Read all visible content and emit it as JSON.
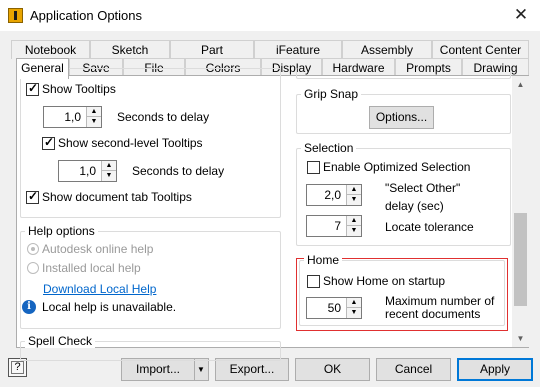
{
  "window": {
    "title": "Application Options",
    "close_glyph": "✕"
  },
  "tabs_back": [
    "Notebook",
    "Sketch",
    "Part",
    "iFeature",
    "Assembly",
    "Content Center"
  ],
  "tabs_front": [
    "General",
    "Save",
    "File",
    "Colors",
    "Display",
    "Hardware",
    "Prompts",
    "Drawing"
  ],
  "active_tab": "General",
  "left": {
    "show_tooltips": {
      "label": "Show Tooltips",
      "checked": true
    },
    "delay1": {
      "value": "1,0",
      "label": "Seconds to delay"
    },
    "second_level": {
      "label": "Show second-level Tooltips",
      "checked": true
    },
    "delay2": {
      "value": "1,0",
      "label": "Seconds to delay"
    },
    "doc_tab_tooltips": {
      "label": "Show document tab Tooltips",
      "checked": true
    },
    "help_options": {
      "title": "Help options",
      "online": {
        "label": "Autodesk online help",
        "selected": true
      },
      "local": {
        "label": "Installed local help",
        "selected": false
      },
      "download_link": "Download Local Help",
      "info_glyph": "i",
      "info_text": "Local help is unavailable."
    },
    "spell_check": {
      "title": "Spell Check"
    }
  },
  "right": {
    "grip_snap": {
      "title": "Grip Snap",
      "options_button": "Options..."
    },
    "selection": {
      "title": "Selection",
      "optimized": {
        "label": "Enable Optimized Selection",
        "checked": false
      },
      "select_other": {
        "value": "2,0",
        "label_line1": "\"Select Other\"",
        "label_line2": "delay (sec)"
      },
      "locate_tolerance": {
        "value": "7",
        "label": "Locate tolerance"
      }
    },
    "home": {
      "title": "Home",
      "show_home": {
        "label": "Show Home on startup",
        "checked": false
      },
      "max_recent": {
        "value": "50",
        "label_line1": "Maximum number of",
        "label_line2": "recent documents"
      }
    }
  },
  "footer": {
    "help_glyph": "?",
    "import_label": "Import...",
    "import_arrow": "▼",
    "export_label": "Export...",
    "ok_label": "OK",
    "cancel_label": "Cancel",
    "apply_label": "Apply"
  },
  "glyphs": {
    "up": "▲",
    "down": "▼"
  }
}
